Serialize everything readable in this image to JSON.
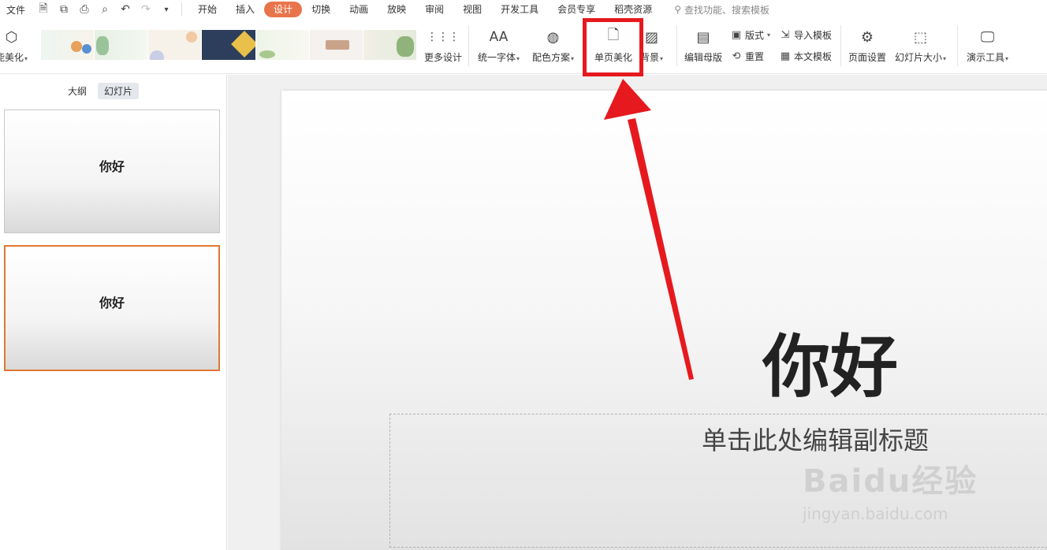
{
  "menubar": {
    "file": "文件",
    "tabs": [
      "开始",
      "插入",
      "设计",
      "切换",
      "动画",
      "放映",
      "审阅",
      "视图",
      "开发工具",
      "会员专享",
      "稻壳资源"
    ],
    "active_tab": "设计",
    "search_placeholder": "查找功能、搜索模板"
  },
  "ribbon": {
    "smart_beautify": "能美化",
    "template_thumbs": [
      "",
      "",
      "",
      "",
      "",
      "",
      ""
    ],
    "more_design": "更多设计",
    "unify_font": "统一字体",
    "color_scheme": "配色方案",
    "single_page_beautify": "单页美化",
    "background": "背景",
    "edit_master": "编辑母版",
    "layout": "版式",
    "reset": "重置",
    "import_template": "导入模板",
    "text_template": "本文模板",
    "page_setup": "页面设置",
    "slide_size": "幻灯片大小",
    "present_tools": "演示工具"
  },
  "left_panel": {
    "tab_outline": "大纲",
    "tab_slides": "幻灯片",
    "slides": [
      {
        "title": "你好"
      },
      {
        "title": "你好"
      }
    ],
    "selected_index": 1
  },
  "slide": {
    "title": "你好",
    "subtitle_placeholder": "单击此处编辑副标题"
  },
  "watermark": {
    "brand": "Baidu经验",
    "url": "jingyan.baidu.com"
  },
  "colors": {
    "accent_tab": "#e8744c",
    "highlight_red": "#e6191e",
    "selected_border": "#e0762f"
  }
}
